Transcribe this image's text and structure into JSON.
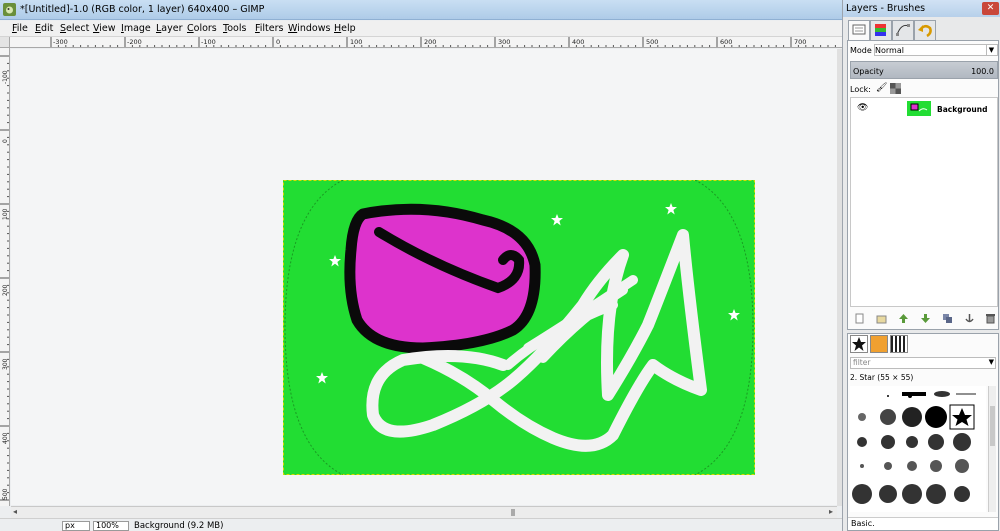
{
  "window": {
    "title": "*[Untitled]-1.0 (RGB color, 1 layer) 640x400 – GIMP"
  },
  "menu": [
    "File",
    "Edit",
    "Select",
    "View",
    "Image",
    "Layer",
    "Colors",
    "Tools",
    "Filters",
    "Windows",
    "Help"
  ],
  "ruler": {
    "h_labels": [
      "-300",
      "-200",
      "-100",
      "0",
      "100",
      "200",
      "300",
      "400",
      "500",
      "600",
      "700"
    ],
    "v_labels": [
      "-100",
      "0",
      "100",
      "200",
      "300",
      "400",
      "500"
    ]
  },
  "statusbar": {
    "unit": "px",
    "zoom": "100%",
    "info": "Background (9.2 MB)"
  },
  "dock": {
    "title": "Layers - Brushes",
    "close_icon": "close-icon",
    "tabs": [
      "layers-tab-icon",
      "channels-tab-icon",
      "paths-tab-icon",
      "undo-tab-icon"
    ],
    "layers": {
      "mode_label": "Mode",
      "mode_value": "Normal",
      "opacity_label": "Opacity",
      "opacity_value": "100.0",
      "lock_label": "Lock:",
      "layer_name": "Background",
      "buttons": [
        "new-layer-icon",
        "new-group-icon",
        "raise-icon",
        "lower-icon",
        "duplicate-icon",
        "anchor-icon",
        "delete-icon"
      ]
    },
    "brushes": {
      "filter_placeholder": "filter",
      "selected_brush": "2. Star (55 × 55)",
      "preset": "Basic."
    }
  },
  "colors": {
    "canvas_green": "#22dd33",
    "shape_magenta": "#dd33cc",
    "stroke_black": "#0a0a0a",
    "scribble_white": "#f2f2f2"
  }
}
